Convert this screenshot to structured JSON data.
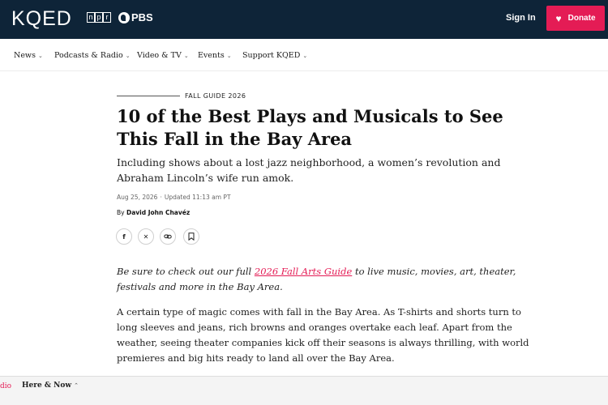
{
  "header": {
    "logo": "KQED",
    "partner_npr": [
      "n",
      "p",
      "r"
    ],
    "partner_pbs": "PBS",
    "signin_label": "Sign In",
    "donate_label": "Donate",
    "donate_color": "#e41c55",
    "bg_color": "#0e2438"
  },
  "nav": {
    "items": [
      {
        "label": "News"
      },
      {
        "label": "Podcasts & Radio"
      },
      {
        "label": "Video & TV"
      },
      {
        "label": "Events"
      },
      {
        "label": "Support KQED"
      }
    ]
  },
  "article": {
    "kicker": "FALL GUIDE 2026",
    "headline": "10 of the Best Plays and Musicals to See This Fall in the Bay Area",
    "dek": "Including shows about a lost jazz neighborhood, a women’s revolution and Abraham Lincoln’s wife run amok.",
    "date": "Aug 25, 2026",
    "updated": "Updated 11:13 am PT",
    "byline_prefix": "By",
    "author": "David John Chavéz",
    "share_icons": [
      "facebook-icon",
      "x-icon",
      "link-icon",
      "bookmark-icon"
    ],
    "promo_before": "Be sure to check out our full ",
    "promo_link": "2026 Fall Arts Guide",
    "promo_after": " to live music, movies, art, theater, festivals and more in the Bay Area.",
    "paragraph": "A certain type of magic comes with fall in the Bay Area. As T-shirts and shorts turn to long sleeves and jeans, rich browns and oranges overtake each leaf. Apart from the weather, seeing theater companies kick off their seasons is always thrilling, with world premieres and big hits ready to land all over the Bay Area."
  },
  "player": {
    "radio_label": "dio",
    "show_label": "Here & Now"
  }
}
